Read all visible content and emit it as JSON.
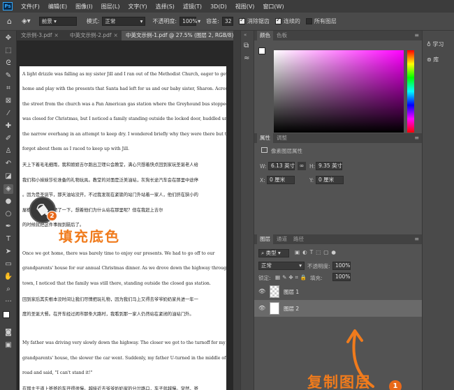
{
  "app": {
    "logo": "Ps"
  },
  "menu": [
    "文件(F)",
    "编辑(E)",
    "图像(I)",
    "图层(L)",
    "文字(Y)",
    "选择(S)",
    "滤镜(T)",
    "3D(D)",
    "视图(V)",
    "窗口(W)"
  ],
  "options": {
    "fill_source": "前景",
    "mode_label": "模式:",
    "mode_value": "正常",
    "opacity_label": "不透明度:",
    "opacity_value": "100%",
    "tolerance_label": "容差:",
    "tolerance_value": "32",
    "antialias_label": "消除锯齿",
    "antialias_checked": true,
    "contiguous_label": "连续的",
    "contiguous_checked": true,
    "all_layers_label": "所有图层",
    "all_layers_checked": false
  },
  "tabs": [
    {
      "label": "文示例-3.pdf",
      "active": false
    },
    {
      "label": "中英文示例-2.pdf",
      "active": false
    },
    {
      "label": "中英文示例-1.pdf @ 27.5% (图层 2, RGB/8)",
      "active": true
    }
  ],
  "tab_close": "×",
  "document": {
    "lines": [
      {
        "text": "A light drizzle was falling as my sister Jill and I ran out of the Methodist Church, eager to get",
        "zh": false
      },
      {
        "text": "home and play with the presents that Santa had left for us and our baby sister, Sharon. Across",
        "zh": false
      },
      {
        "text": "the street from the church was a Pan American gas station where the Greyhound bus stopped. It",
        "zh": false
      },
      {
        "text": "was closed for Christmas, but I noticed a family standing outside the locked door, huddled under",
        "zh": false
      },
      {
        "text": "the narrow overhang in an attempt to keep dry. I wondered briefly why they were there but then",
        "zh": false
      },
      {
        "text": "forgot about them as I raced to keep up with Jill.",
        "zh": false
      },
      {
        "text": "天上下着毛毛细雨，我和姐姐吉尔跑出卫理公会教堂，满心只想着快点回到家玩圣诞老人给",
        "zh": true
      },
      {
        "text": "我们和小妹妹莎伦准备的礼物玩具。教堂的对面是泛美油站，灰狗长途汽车会在那里中途停",
        "zh": true
      },
      {
        "text": "。因为是圣诞节，那天油站没开，不过我发现在紧锁的站门外站着一家人，他们挤在狭小的",
        "zh": true
      },
      {
        "text": "屋檐下避雨。我愣了一下，想着他们为什么站在那里呢？但在我赶上吉尔",
        "zh": true
      },
      {
        "text": "的时候就把这件事抛到脑后了。",
        "zh": true
      },
      {
        "text": "",
        "zh": false
      },
      {
        "text": "Once we got home, there was barely time to enjoy our presents. We had to go off to our",
        "zh": false
      },
      {
        "text": "grandparents' house for our annual Christmas dinner. As we drove down the highway through",
        "zh": false
      },
      {
        "text": "town, I noticed that the family was still there, standing outside the closed gas station.",
        "zh": false
      },
      {
        "text": "回到家后其实根本没时间让我们尽情把玩礼物，因为我们马上又得去爷爷奶奶家共进一年一",
        "zh": true
      },
      {
        "text": "度的圣诞大餐。在开车经过闹市那条大路时，我看到那一家人仍然站在紧闭的油站门外。",
        "zh": true
      },
      {
        "text": "",
        "zh": false
      },
      {
        "text": "My father was driving very slowly down the highway. The closer we got to the turnoff for my",
        "zh": false
      },
      {
        "text": "grandparents' house, the slower the car went. Suddenly, my father U-turned in the middle of the",
        "zh": false
      },
      {
        "text": "road and said, \"I can't stand it!\"",
        "zh": false
      },
      {
        "text": "在那主干道上爸爸的车开得很慢。越接近去爷爷奶奶家的分岔路口，车子就越慢。突然，爸",
        "zh": true
      }
    ]
  },
  "annotations": {
    "step2_number": "2",
    "fill_label": "填充底色",
    "copy_label": "复制图层",
    "step1_number": "1"
  },
  "color_panel": {
    "tabs": [
      "颜色",
      "色板"
    ]
  },
  "properties_panel": {
    "tabs": [
      "属性",
      "调整"
    ],
    "title": "像素图层属性",
    "w_label": "W:",
    "w_value": "6.13 英寸",
    "h_label": "H:",
    "h_value": "9.35 英寸",
    "x_label": "X:",
    "x_value": "0 厘米",
    "y_label": "Y:",
    "y_value": "0 厘米"
  },
  "layers_panel": {
    "tabs": [
      "图层",
      "通道",
      "路径"
    ],
    "kind_filter": "类型",
    "blend_mode": "正常",
    "opacity_label": "不透明度:",
    "opacity_value": "100%",
    "lock_label": "锁定:",
    "fill_label": "填充:",
    "fill_value": "100%",
    "layers": [
      {
        "name": "图层 1",
        "thumb": "checker",
        "selected": false
      },
      {
        "name": "图层 2",
        "thumb": "white",
        "selected": true
      }
    ]
  },
  "right_dock": {
    "learn": "学习",
    "library": "库"
  },
  "panel_menu_icon": "≡"
}
